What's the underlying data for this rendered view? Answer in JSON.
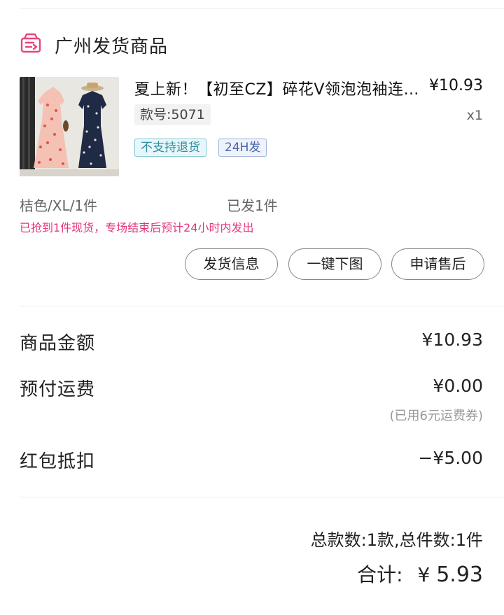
{
  "header": {
    "title": "广州发货商品",
    "icon": "shipping-box-icon",
    "accent": "#e8457f"
  },
  "product": {
    "title": "夏上新！【初至CZ】碎花V领泡泡袖连衣裙",
    "price": "¥10.93",
    "quantity": "x1",
    "sku": "款号:5071",
    "tags": [
      "不支持退货",
      "24H发"
    ],
    "spec": "桔色/XL/1件",
    "shipped": "已发1件",
    "notice": "已抢到1件现货，专场结束后预计24小时内发出"
  },
  "actions": {
    "shipping_info": "发货信息",
    "download_images": "一键下图",
    "after_sales": "申请售后"
  },
  "fees": {
    "goods_label": "商品金额",
    "goods_value": "¥10.93",
    "freight_label": "预付运费",
    "freight_value": "¥0.00",
    "freight_note": "(已用6元运费券)",
    "redpacket_label": "红包抵扣",
    "redpacket_value": "−¥5.00"
  },
  "summary": {
    "counts": "总款数:1款,总件数:1件",
    "total_label": "合计:",
    "total_currency": "¥",
    "total_amount": "5.93"
  }
}
